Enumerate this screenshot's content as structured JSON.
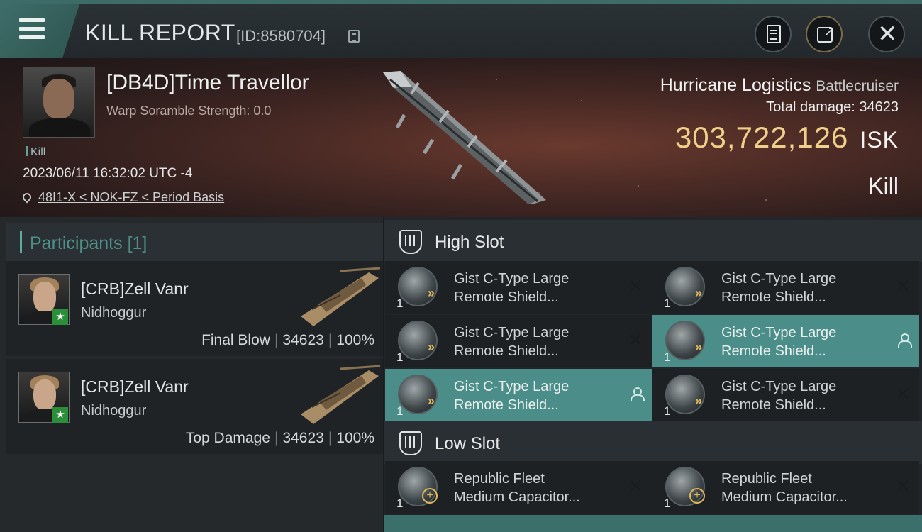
{
  "header": {
    "title": "KILL REPORT",
    "report_id": "[ID:8580704]",
    "icons": [
      "menu-icon",
      "copy-icon",
      "clipboard-icon",
      "share-icon",
      "close-icon"
    ]
  },
  "victim": {
    "name": "[DB4D]Time Travellor",
    "warp_scramble": "Warp Soramble Strength: 0.0",
    "kill_tag": "Kill",
    "datetime": "2023/06/11 16:32:02 UTC -4",
    "location": "48I1-X < NOK-FZ < Period Basis",
    "ship_name": "Hurricane Logistics",
    "ship_class": "Battlecruiser",
    "total_damage_label": "Total damage:",
    "total_damage": "34623",
    "isk_value": "303,722,126",
    "isk_unit": "ISK",
    "result": "Kill"
  },
  "participants": {
    "title": "Participants",
    "count": "[1]",
    "items": [
      {
        "name": "[CRB]Zell Vanr",
        "ship": "Nidhoggur",
        "role": "Final Blow",
        "damage": "34623",
        "percent": "100%"
      },
      {
        "name": "[CRB]Zell Vanr",
        "ship": "Nidhoggur",
        "role": "Top Damage",
        "damage": "34623",
        "percent": "100%"
      }
    ]
  },
  "slots": {
    "high": {
      "label": "High Slot",
      "modules": [
        {
          "line1": "Gist C-Type Large",
          "line2": "Remote Shield...",
          "qty": "1",
          "state": "destroyed"
        },
        {
          "line1": "Gist C-Type Large",
          "line2": "Remote Shield...",
          "qty": "1",
          "state": "destroyed"
        },
        {
          "line1": "Gist C-Type Large",
          "line2": "Remote Shield...",
          "qty": "1",
          "state": "destroyed"
        },
        {
          "line1": "Gist C-Type Large",
          "line2": "Remote Shield...",
          "qty": "1",
          "state": "dropped"
        },
        {
          "line1": "Gist C-Type Large",
          "line2": "Remote Shield...",
          "qty": "1",
          "state": "dropped"
        },
        {
          "line1": "Gist C-Type Large",
          "line2": "Remote Shield...",
          "qty": "1",
          "state": "destroyed"
        }
      ]
    },
    "low": {
      "label": "Low Slot",
      "modules": [
        {
          "line1": "Republic Fleet",
          "line2": "Medium Capacitor...",
          "qty": "1",
          "state": "destroyed"
        },
        {
          "line1": "Republic Fleet",
          "line2": "Medium Capacitor...",
          "qty": "1",
          "state": "destroyed"
        }
      ]
    }
  },
  "colors": {
    "accent": "#4b8d88",
    "isk": "#f0cf8a",
    "teal_text": "#4f8f89"
  }
}
